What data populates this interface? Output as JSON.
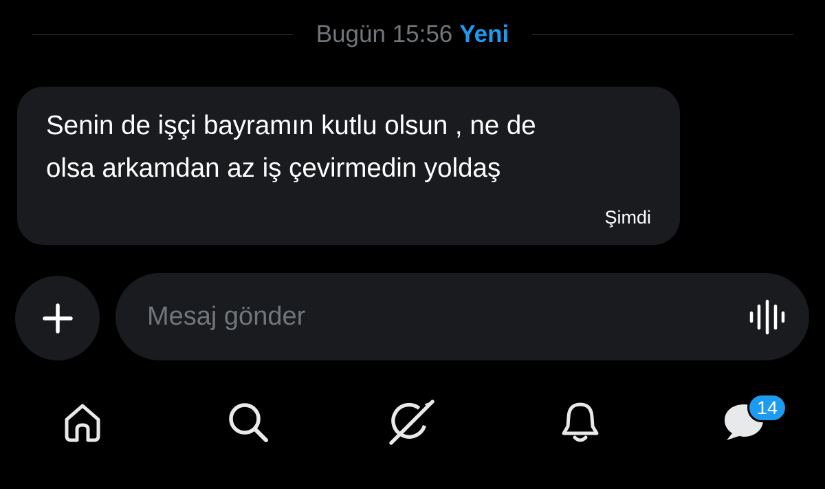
{
  "divider": {
    "date_label": "Bugün 15:56",
    "new_label": "Yeni"
  },
  "message": {
    "line1": "Senin de işçi bayramın kutlu olsun , ne de",
    "line2": "olsa arkamdan az iş çevirmedin yoldaş",
    "time": "Şimdi"
  },
  "composer": {
    "attach_icon": "plus-icon",
    "placeholder": "Mesaj gönder",
    "voice_icon": "voice-waveform-icon"
  },
  "bottom_nav": {
    "items": [
      {
        "icon": "home-icon"
      },
      {
        "icon": "search-icon"
      },
      {
        "icon": "grok-icon"
      },
      {
        "icon": "notifications-bell-icon"
      },
      {
        "icon": "messages-icon",
        "badge": "14"
      }
    ]
  },
  "colors": {
    "background": "#000000",
    "bubble": "#1a1b1e",
    "accent": "#1d9bf0",
    "muted_text": "#71767b",
    "text": "#ffffff"
  }
}
